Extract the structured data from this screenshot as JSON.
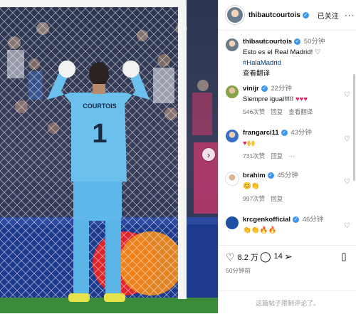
{
  "photo": {
    "jersey_name": "COURTOIS",
    "jersey_number": "1",
    "next_icon": "chevron-right-icon"
  },
  "header": {
    "username": "thibautcourtois",
    "follow_label": "已关注",
    "more_label": "···"
  },
  "caption": {
    "username": "thibautcourtois",
    "time": "50分钟",
    "text": "Esto es el Real Madrid! ♡",
    "hashtag": "#HalaMadrid",
    "translate": "查看翻译"
  },
  "comments": [
    {
      "username": "vinijr",
      "time": "22分钟",
      "text": "Siempre igual!!!!!",
      "emoji": "♥♥♥",
      "likes": "546次赞",
      "reply": "回复",
      "translate": "查看翻译"
    },
    {
      "username": "frangarci11",
      "time": "43分钟",
      "emoji": "♥🙌",
      "likes": "731次赞",
      "reply": "回复",
      "more": "···"
    },
    {
      "username": "brahim",
      "time": "45分钟",
      "emoji": "😊👏",
      "likes": "997次赞",
      "reply": "回复"
    },
    {
      "username": "krcgenkofficial",
      "time": "46分钟",
      "emoji": "👏👏🔥🔥"
    }
  ],
  "actions": {
    "likes_count": "8.2 万",
    "comments_count": "14"
  },
  "time_ago": "50分钟前",
  "comments_closed": "这篇帖子限制评论了。",
  "colors": {
    "verified": "#3897f0",
    "like": "#e0245e",
    "kit": "#5ab4e6"
  }
}
